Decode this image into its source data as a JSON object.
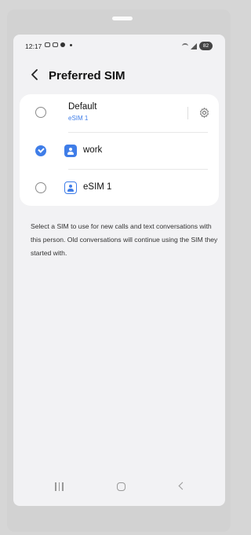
{
  "status_bar": {
    "time": "12:17",
    "battery": "82"
  },
  "header": {
    "back_icon": "back-chevron-icon",
    "title": "Preferred SIM"
  },
  "sim_options": [
    {
      "title": "Default",
      "subtitle": "eSIM 1",
      "selected": false,
      "has_settings": true
    },
    {
      "title": "work",
      "badge": "filled",
      "selected": true
    },
    {
      "title": "eSIM 1",
      "badge": "outline",
      "selected": false
    }
  ],
  "description": "Select a SIM to use for new calls and text conversations with this person. Old conversations will continue using the SIM they started with.",
  "nav_bar": {
    "recents_icon": "recents-icon",
    "home_icon": "home-icon",
    "back_icon": "nav-back-icon"
  },
  "colors": {
    "accent": "#3f7de8",
    "card": "#ffffff",
    "screen_bg": "#f2f2f4"
  }
}
